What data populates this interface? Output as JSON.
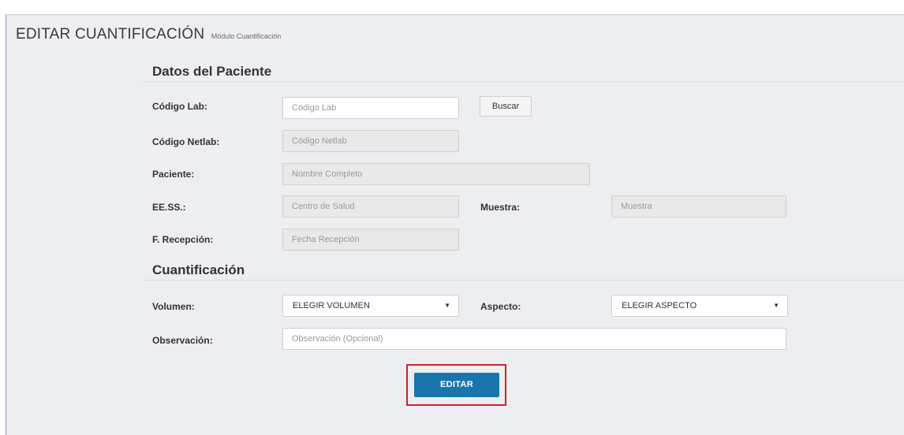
{
  "header": {
    "title": "EDITAR CUANTIFICACIÓN",
    "subtitle": "Módulo Cuantificación"
  },
  "patient_section": {
    "title": "Datos del Paciente",
    "codigo_lab": {
      "label": "Código Lab:",
      "placeholder": "Código Lab"
    },
    "buscar_label": "Buscar",
    "codigo_netlab": {
      "label": "Código Netlab:",
      "placeholder": "Código Netlab"
    },
    "paciente": {
      "label": "Paciente:",
      "placeholder": "Nombre Completo"
    },
    "eess": {
      "label": "EE.SS.:",
      "placeholder": "Centro de Salud"
    },
    "muestra": {
      "label": "Muestra:",
      "placeholder": "Muestra"
    },
    "recepcion": {
      "label": "F. Recepción:",
      "placeholder": "Fecha Recepción"
    }
  },
  "quant_section": {
    "title": "Cuantificación",
    "volumen": {
      "label": "Volumen:",
      "value": "ELEGIR VOLUMEN"
    },
    "aspecto": {
      "label": "Aspecto:",
      "value": "ELEGIR ASPECTO"
    },
    "observacion": {
      "label": "Observación:",
      "placeholder": "Observación (Opcional)"
    }
  },
  "submit_label": "EDITAR",
  "colors": {
    "panel_bg": "#eceef1",
    "primary_button": "#1976ad",
    "highlight_border": "#d0202a",
    "readonly_input": "#e9e9e9"
  },
  "icons": {
    "dropdown": "triangle-down-icon"
  }
}
